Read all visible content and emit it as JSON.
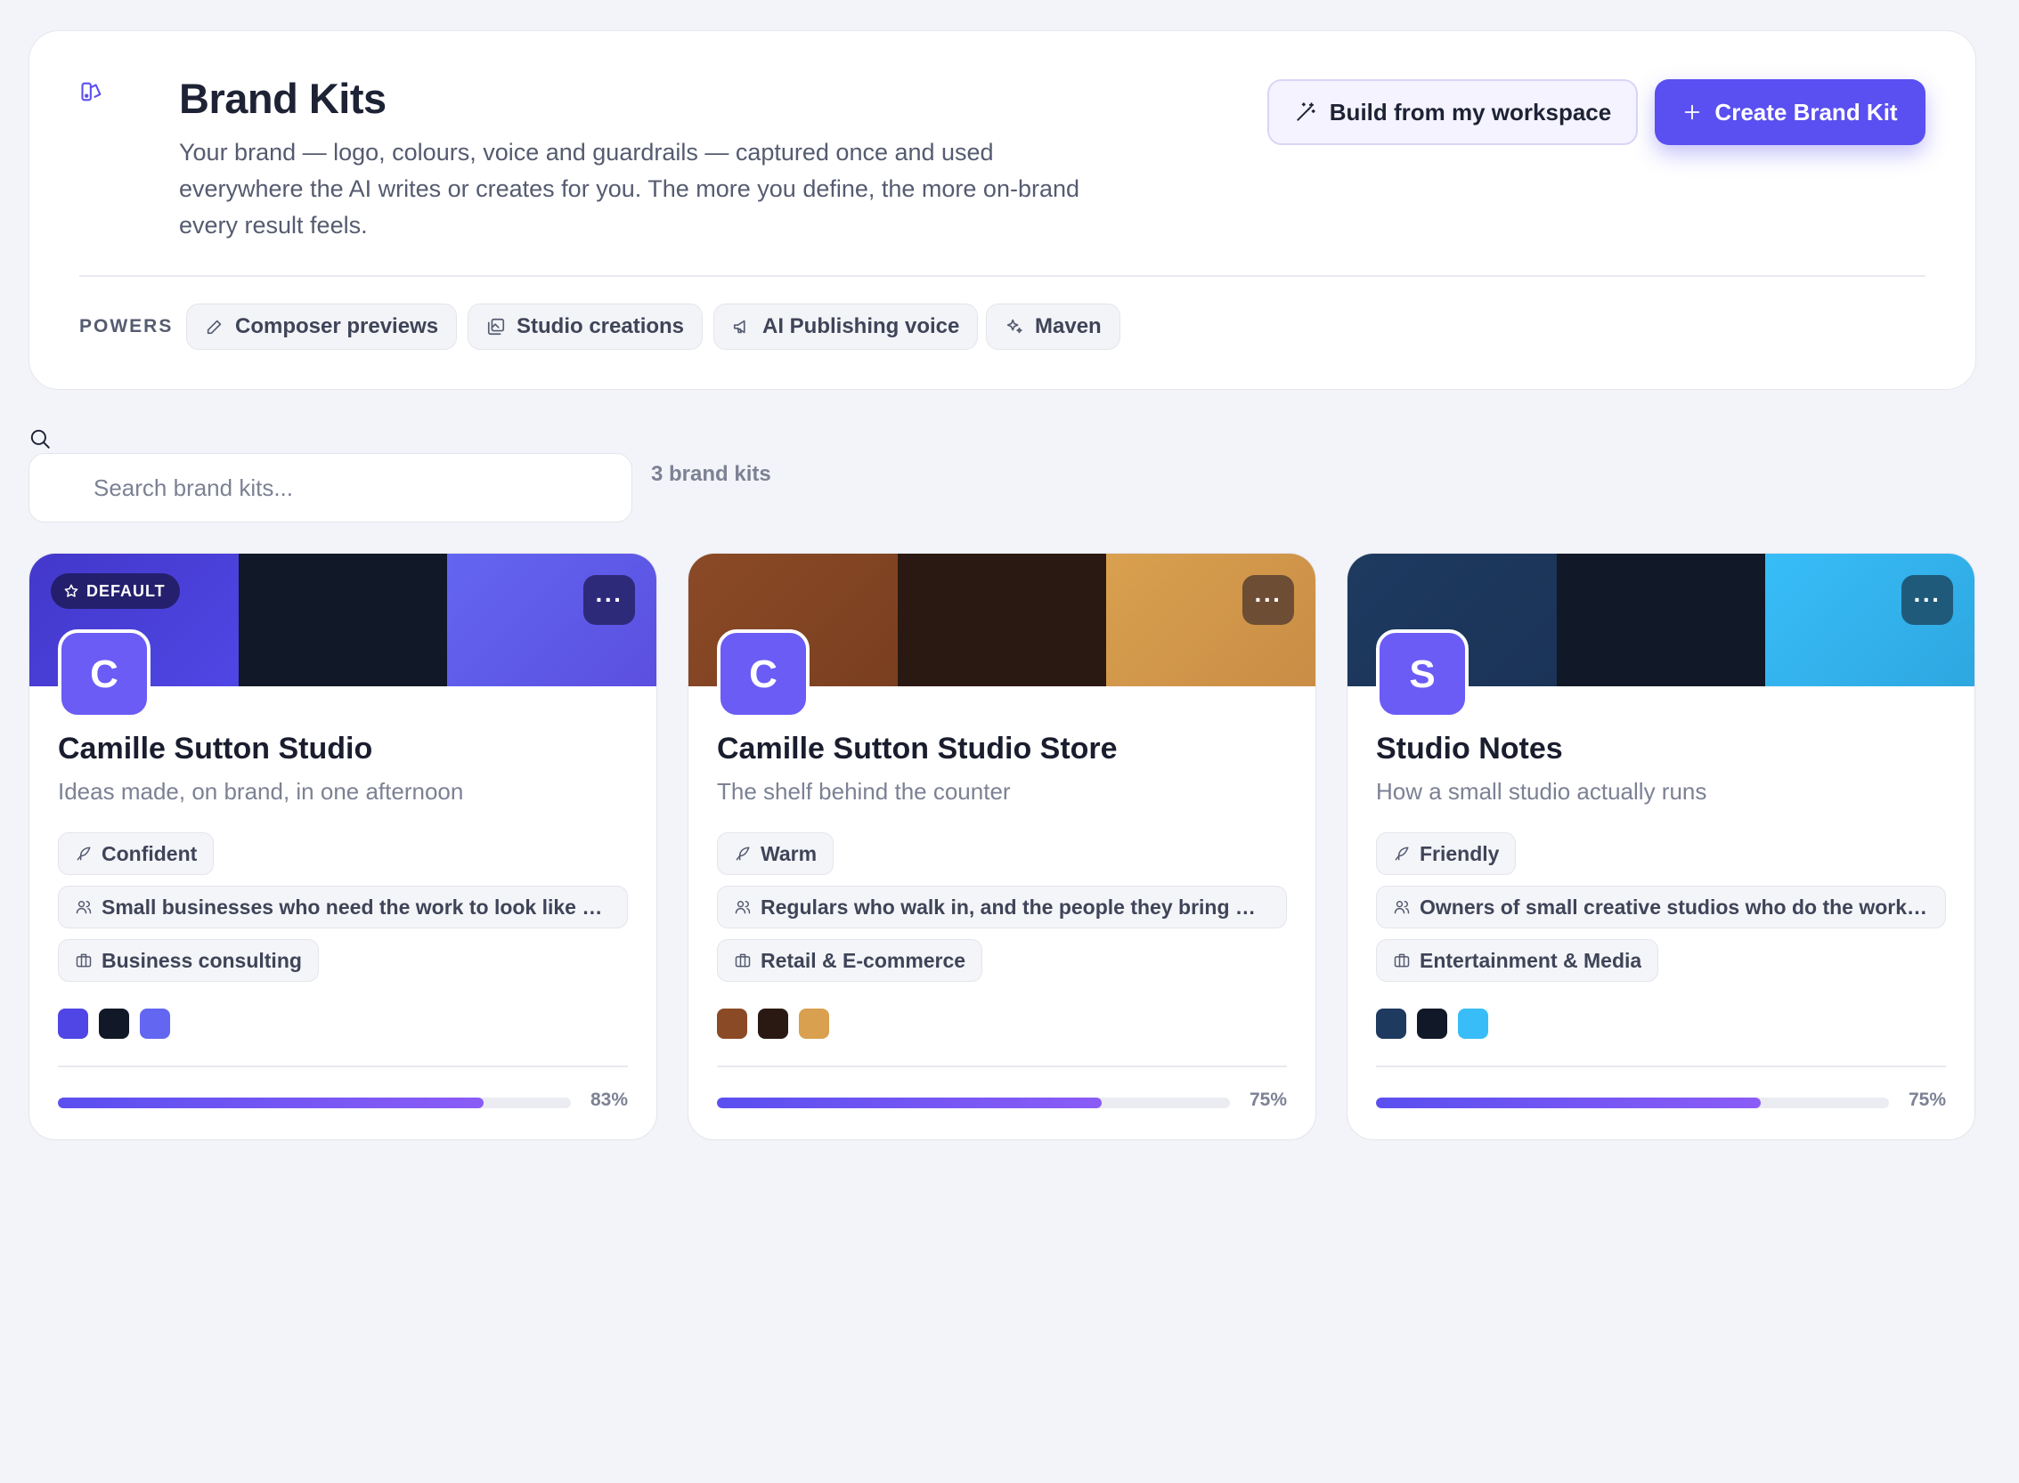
{
  "header": {
    "title": "Brand Kits",
    "description": "Your brand — logo, colours, voice and guardrails — captured once and used everywhere the AI writes or creates for you. The more you define, the more on-brand every result feels.",
    "build_button": "Build from my workspace",
    "create_button": "Create Brand Kit",
    "powers_label": "POWERS",
    "powers": [
      {
        "label": "Composer previews",
        "icon": "pencil-icon"
      },
      {
        "label": "Studio creations",
        "icon": "images-icon"
      },
      {
        "label": "AI Publishing voice",
        "icon": "megaphone-icon"
      },
      {
        "label": "Maven",
        "icon": "sparkles-icon"
      }
    ]
  },
  "search": {
    "placeholder": "Search brand kits...",
    "count_label": "3 brand kits"
  },
  "cards": [
    {
      "name": "Camille Sutton Studio",
      "tagline": "Ideas made, on brand, in one afternoon",
      "avatar_letter": "C",
      "is_default": true,
      "default_label": "DEFAULT",
      "voice": "Confident",
      "audience": "Small businesses who need the work to look like on...",
      "industry": "Business consulting",
      "colors": [
        "#4f46e5",
        "#111827",
        "#6366f1"
      ],
      "menu_color": "#2e2a7a",
      "progress": 0.83,
      "progress_label": "83%"
    },
    {
      "name": "Camille Sutton Studio Store",
      "tagline": "The shelf behind the counter",
      "avatar_letter": "C",
      "is_default": false,
      "voice": "Warm",
      "audience": "Regulars who walk in, and the people they bring wit...",
      "industry": "Retail & E-commerce",
      "colors": [
        "#8b4a26",
        "#2a1912",
        "#d9a04f"
      ],
      "menu_color": "#6e4d35",
      "progress": 0.75,
      "progress_label": "75%"
    },
    {
      "name": "Studio Notes",
      "tagline": "How a small studio actually runs",
      "avatar_letter": "S",
      "is_default": false,
      "voice": "Friendly",
      "audience": "Owners of small creative studios who do the work t...",
      "industry": "Entertainment & Media",
      "colors": [
        "#1e3a5f",
        "#111827",
        "#38bdf8"
      ],
      "menu_color": "#1f5a7a",
      "progress": 0.75,
      "progress_label": "75%"
    }
  ]
}
